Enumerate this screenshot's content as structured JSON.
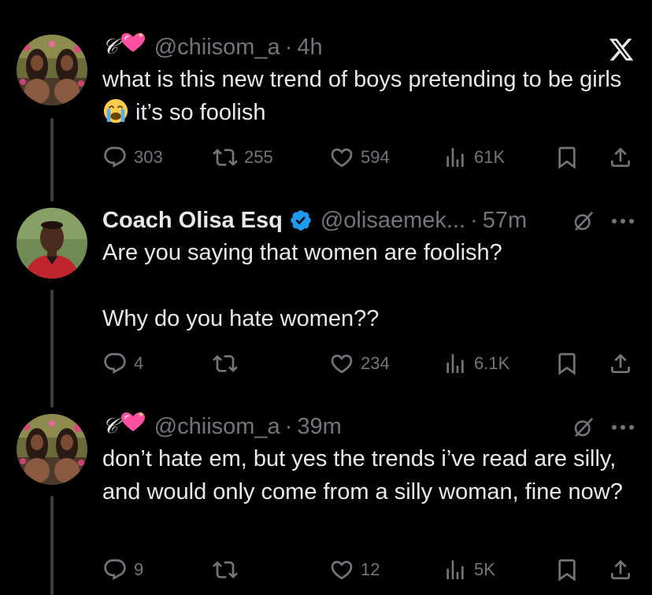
{
  "tweets": [
    {
      "display_name": "𝒞",
      "handle": "@chiisom_a",
      "time": "4h",
      "text": "what is this new trend of boys pretending to be girls",
      "text_after_emoji": "it’s so foolish",
      "emoji": "loudly-crying-face",
      "stats": {
        "replies": "303",
        "reposts": "255",
        "likes": "594",
        "views": "61K"
      }
    },
    {
      "display_name": "Coach Olisa Esq",
      "verified": true,
      "handle": "@olisaemek...",
      "time": "57m",
      "text": "Are you saying that women are foolish?\n\nWhy do you hate women??",
      "stats": {
        "replies": "4",
        "reposts": "",
        "likes": "234",
        "views": "6.1K"
      }
    },
    {
      "display_name": "𝒞",
      "handle": "@chiisom_a",
      "time": "39m",
      "text": "don’t hate em, but yes the trends i’ve read are silly, and would only come from a silly woman, fine now?",
      "stats": {
        "replies": "9",
        "reposts": "",
        "likes": "12",
        "views": "5K"
      }
    }
  ],
  "colors": {
    "background": "#000000",
    "text": "#e7e9ea",
    "muted": "#71767b",
    "verified": "#1d9bf0",
    "heart_emoji": "#ff4fa3"
  },
  "icons": [
    "x-logo-icon",
    "grok-icon",
    "more-icon",
    "reply-icon",
    "repost-icon",
    "like-icon",
    "views-icon",
    "bookmark-icon",
    "share-icon",
    "verified-badge-icon",
    "sparkling-heart-icon"
  ]
}
